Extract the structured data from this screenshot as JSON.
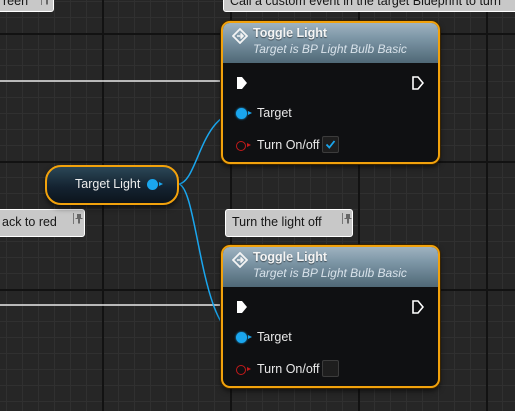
{
  "comments": {
    "top_left": "reen",
    "top_right": "Call a custom event in the target Blueprint to turn",
    "left": "ack to red",
    "middle": "Turn the light off"
  },
  "variable_node": {
    "label": "Target Light",
    "pin_color": "#1aa6ee"
  },
  "nodes": [
    {
      "title": "Toggle Light",
      "subtitle": "Target is BP Light Bulb Basic",
      "target_label": "Target",
      "toggle_label": "Turn On/off",
      "checked": true
    },
    {
      "title": "Toggle Light",
      "subtitle": "Target is BP Light Bulb Basic",
      "target_label": "Target",
      "toggle_label": "Turn On/off",
      "checked": false
    }
  ],
  "colors": {
    "selection_outline": "#f2a20c",
    "object_pin": "#1aa6ee",
    "bool_pin": "#c21a1a",
    "header": "#7f98a8"
  }
}
